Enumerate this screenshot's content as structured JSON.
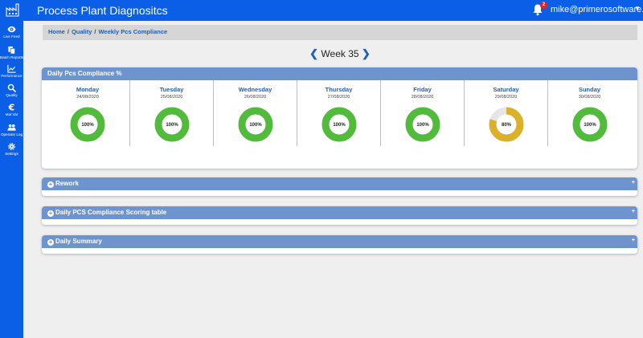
{
  "app": {
    "title": "Process Plant Diagnositcs"
  },
  "header": {
    "notification_count": "2",
    "user_email": "mike@primerosoftware.co.uk"
  },
  "sidebar": {
    "items": [
      {
        "label": "Live Feed",
        "icon": "eye-icon"
      },
      {
        "label": "Batch Reports",
        "icon": "copy-icon"
      },
      {
        "label": "Performance",
        "icon": "chart-line-icon"
      },
      {
        "label": "Quality",
        "icon": "search-icon"
      },
      {
        "label": "Mat Var",
        "icon": "euro-icon"
      },
      {
        "label": "Operator Log",
        "icon": "users-icon"
      },
      {
        "label": "Settings",
        "icon": "gear-icon"
      }
    ]
  },
  "breadcrumb": {
    "home": "Home",
    "quality": "Quality",
    "current": "Weekly Pcs Compliance",
    "separator": "/"
  },
  "week": {
    "label": "Week 35"
  },
  "compliance_panel": {
    "title": "Daily Pcs Compliance %",
    "days": [
      {
        "name": "Monday",
        "date": "24/08/2020",
        "value": 100,
        "label": "100%"
      },
      {
        "name": "Tuesday",
        "date": "25/08/2020",
        "value": 100,
        "label": "100%"
      },
      {
        "name": "Wednesday",
        "date": "26/08/2020",
        "value": 100,
        "label": "100%"
      },
      {
        "name": "Thursday",
        "date": "27/08/2020",
        "value": 100,
        "label": "100%"
      },
      {
        "name": "Friday",
        "date": "28/08/2020",
        "value": 100,
        "label": "100%"
      },
      {
        "name": "Saturday",
        "date": "29/08/2020",
        "value": 80,
        "label": "80%"
      },
      {
        "name": "Sunday",
        "date": "30/08/2020",
        "value": 100,
        "label": "100%"
      }
    ]
  },
  "collapsed_panels": [
    {
      "title": "Rework"
    },
    {
      "title": "Daily PCS Compliance Scoring table"
    },
    {
      "title": "Daily Summary"
    }
  ],
  "colors": {
    "full": "#52bb3c",
    "partial": "#dbb12c",
    "remainder": "#e6e6e6",
    "primary": "#0b5fe6",
    "panel_header": "#6e94cf"
  }
}
